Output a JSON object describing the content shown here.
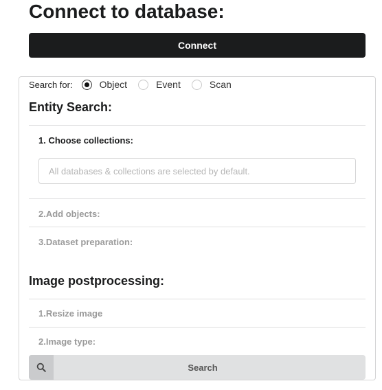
{
  "page": {
    "title": "Connect to database:",
    "connect_label": "Connect"
  },
  "search_for": {
    "label": "Search for:",
    "options": [
      "Object",
      "Event",
      "Scan"
    ],
    "selected": "Object"
  },
  "entity_search": {
    "title": "Entity Search:",
    "steps": [
      "1. Choose collections:",
      "2.Add objects:",
      "3.Dataset preparation:"
    ],
    "collections_placeholder": "All databases & collections are selected by default.",
    "collections_value": ""
  },
  "postprocessing": {
    "title": "Image postprocessing:",
    "steps": [
      "1.Resize image",
      "2.Image type:"
    ]
  },
  "search_button": {
    "label": "Search",
    "icon": "search-icon"
  },
  "colors": {
    "primary_button": "#1b1c1d",
    "secondary_button": "#e0e1e2",
    "muted_text": "#9a9a9a"
  }
}
